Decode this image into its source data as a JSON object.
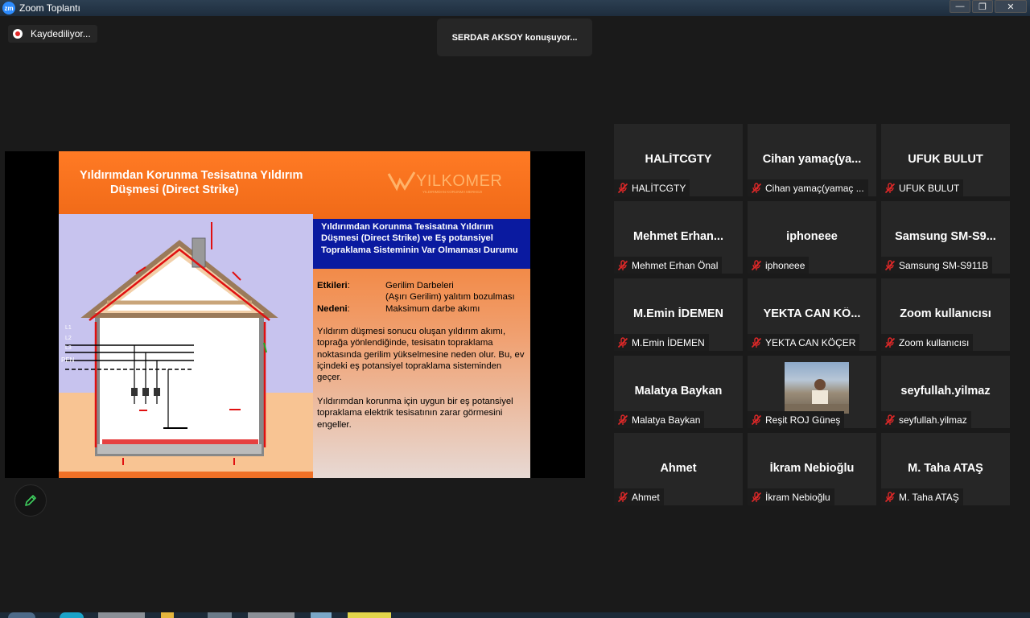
{
  "app": {
    "title": "Zoom Toplantı",
    "window_buttons": [
      "minimize",
      "restore",
      "close"
    ]
  },
  "recording": {
    "label": "Kaydediliyor..."
  },
  "speaker": {
    "label": "SERDAR AKSOY konuşuyor..."
  },
  "slide": {
    "title_line1": "Yıldırımdan Korunma Tesisatına Yıldırım",
    "title_line2": "Düşmesi (Direct Strike)",
    "logo_text": "YILKOMER",
    "logo_subtext": "YILDIRIMDAN KORUNMA MERKEZI",
    "diagram_labels": [
      "L1",
      "L2",
      "L3",
      "PEN"
    ],
    "box_heading": "Yıldırımdan Korunma Tesisatına Yıldırım Düşmesi (Direct Strike)  ve Eş potansiyel Topraklama Sisteminin Var Olmaması Durumu",
    "effects_key": "Etkileri",
    "effects_value_1": "Gerilim Darbeleri",
    "effects_value_2": "(Aşırı Gerilim) yalıtım bozulması",
    "cause_key": "Nedeni",
    "cause_value": "Maksimum  darbe akımı",
    "paragraph1": "Yıldırım düşmesi sonucu oluşan yıldırım akımı, toprağa yönlendiğinde, tesisatın topraklama noktasında gerilim yükselmesine neden olur. Bu, ev içindeki eş potansiyel topraklama sisteminden geçer.",
    "paragraph2": "Yıldırımdan korunma için uygun bir eş potansiyel topraklama elektrik tesisatının zarar görmesini engeller.",
    "colors": {
      "header": "#f07020",
      "box_heading": "#0a1aa0",
      "diagram_bg": "#c7c3ee"
    }
  },
  "participants": [
    {
      "display": "HALİTCGTY",
      "name": "HALİTCGTY",
      "muted": true
    },
    {
      "display": "Cihan  yamaç(ya...",
      "name": "Cihan yamaç(yamaç ...",
      "muted": true
    },
    {
      "display": "UFUK BULUT",
      "name": "UFUK BULUT",
      "muted": true
    },
    {
      "display": "Mehmet  Erhan...",
      "name": "Mehmet Erhan Önal",
      "muted": true
    },
    {
      "display": "iphoneee",
      "name": " iphoneee",
      "muted": true
    },
    {
      "display": "Samsung  SM-S9...",
      "name": "Samsung SM-S911B",
      "muted": true
    },
    {
      "display": "M.Emin İDEMEN",
      "name": "M.Emin İDEMEN",
      "muted": true
    },
    {
      "display": "YEKTA CAN  KÖ...",
      "name": "YEKTA CAN KÖÇER",
      "muted": true
    },
    {
      "display": "Zoom kullanıcısı",
      "name": "Zoom kullanıcısı",
      "muted": true
    },
    {
      "display": "Malatya Baykan",
      "name": "Malatya Baykan",
      "muted": true
    },
    {
      "display": "",
      "name": "Reşit ROJ Güneş",
      "muted": true,
      "video": true
    },
    {
      "display": "seyfullah.yilmaz",
      "name": "seyfullah.yilmaz",
      "muted": true
    },
    {
      "display": "Ahmet",
      "name": "Ahmet",
      "muted": true
    },
    {
      "display": "İkram Nebioğlu",
      "name": "İkram Nebioğlu",
      "muted": true
    },
    {
      "display": "M. Taha ATAŞ",
      "name": "M. Taha ATAŞ",
      "muted": true
    }
  ],
  "icons": {
    "annotate": "pencil-icon",
    "muted": "mic-muted-icon",
    "recording": "record-dot-icon"
  }
}
